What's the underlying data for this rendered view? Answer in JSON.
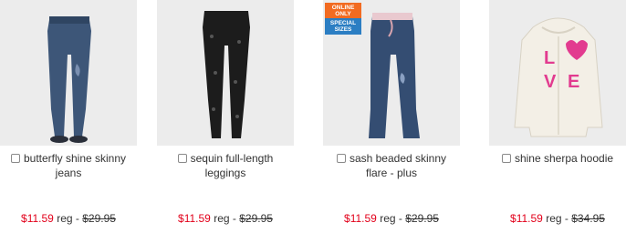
{
  "products": [
    {
      "title_line1": "butterfly shine skinny",
      "title_line2": "jeans",
      "sale_price": "$11.59",
      "reg_label": "reg -",
      "reg_price": "$29.95",
      "image_icon": "jeans-product-image"
    },
    {
      "title_line1": "sequin full-length",
      "title_line2": "leggings",
      "sale_price": "$11.59",
      "reg_label": "reg -",
      "reg_price": "$29.95",
      "image_icon": "leggings-product-image"
    },
    {
      "title_line1": "sash beaded skinny",
      "title_line2": "flare - plus",
      "sale_price": "$11.59",
      "reg_label": "reg -",
      "reg_price": "$29.95",
      "image_icon": "flare-jeans-product-image",
      "badge_top": "ONLINE ONLY",
      "badge_bottom": "SPECIAL SIZES"
    },
    {
      "title_line1": "shine sherpa hoodie",
      "title_line2": "",
      "sale_price": "$11.59",
      "reg_label": "reg -",
      "reg_price": "$34.95",
      "image_icon": "hoodie-product-image"
    }
  ],
  "colors": {
    "sale": "#e2001a",
    "badge_orange": "#f26b21",
    "badge_blue": "#2b7ec3"
  }
}
